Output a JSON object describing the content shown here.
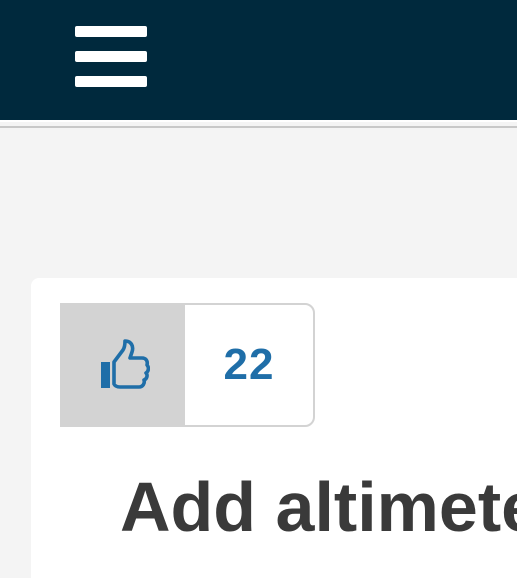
{
  "header": {
    "menu_icon": "hamburger-menu-icon",
    "background_color": "#00293d"
  },
  "vote": {
    "icon": "thumbs-up-icon",
    "count": "22",
    "accent_color": "#1f6ea8"
  },
  "article": {
    "title": "Add altimete"
  }
}
